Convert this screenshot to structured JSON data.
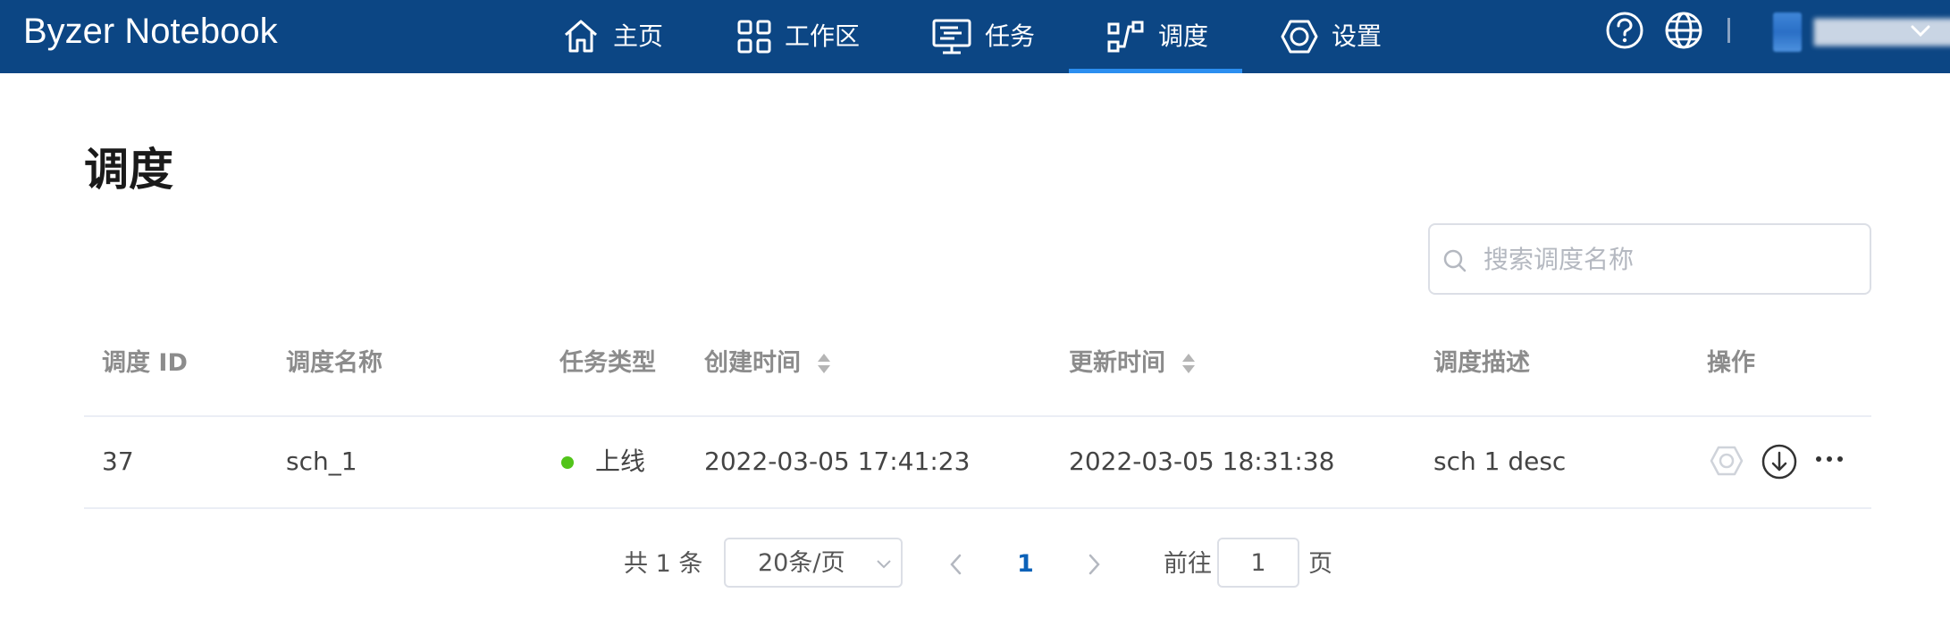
{
  "app": {
    "brand": "Byzer Notebook"
  },
  "nav": {
    "items": [
      {
        "label": "主页",
        "icon": "home-icon"
      },
      {
        "label": "工作区",
        "icon": "grid-icon"
      },
      {
        "label": "任务",
        "icon": "monitor-icon"
      },
      {
        "label": "调度",
        "icon": "schedule-icon",
        "active": true
      },
      {
        "label": "设置",
        "icon": "settings-hexagon-icon"
      }
    ],
    "right_icons": [
      "help-icon",
      "globe-icon"
    ],
    "active_color": "#2b8ef0",
    "bar_color": "#0c4684"
  },
  "page": {
    "title": "调度"
  },
  "search": {
    "placeholder": "搜索调度名称"
  },
  "table": {
    "headers": {
      "id": "调度 ID",
      "name": "调度名称",
      "type": "任务类型",
      "created": "创建时间",
      "updated": "更新时间",
      "desc": "调度描述",
      "ops": "操作"
    },
    "rows": [
      {
        "id": "37",
        "name": "sch_1",
        "status": "上线",
        "status_color": "#52c41a",
        "created": "2022-03-05 17:41:23",
        "updated": "2022-03-05 18:31:38",
        "desc": "sch 1 desc"
      }
    ]
  },
  "pagination": {
    "total_text": "共 1 条",
    "page_size": "20条/页",
    "current_page": "1",
    "goto_label": "前往",
    "goto_value": "1",
    "page_suffix": "页"
  }
}
